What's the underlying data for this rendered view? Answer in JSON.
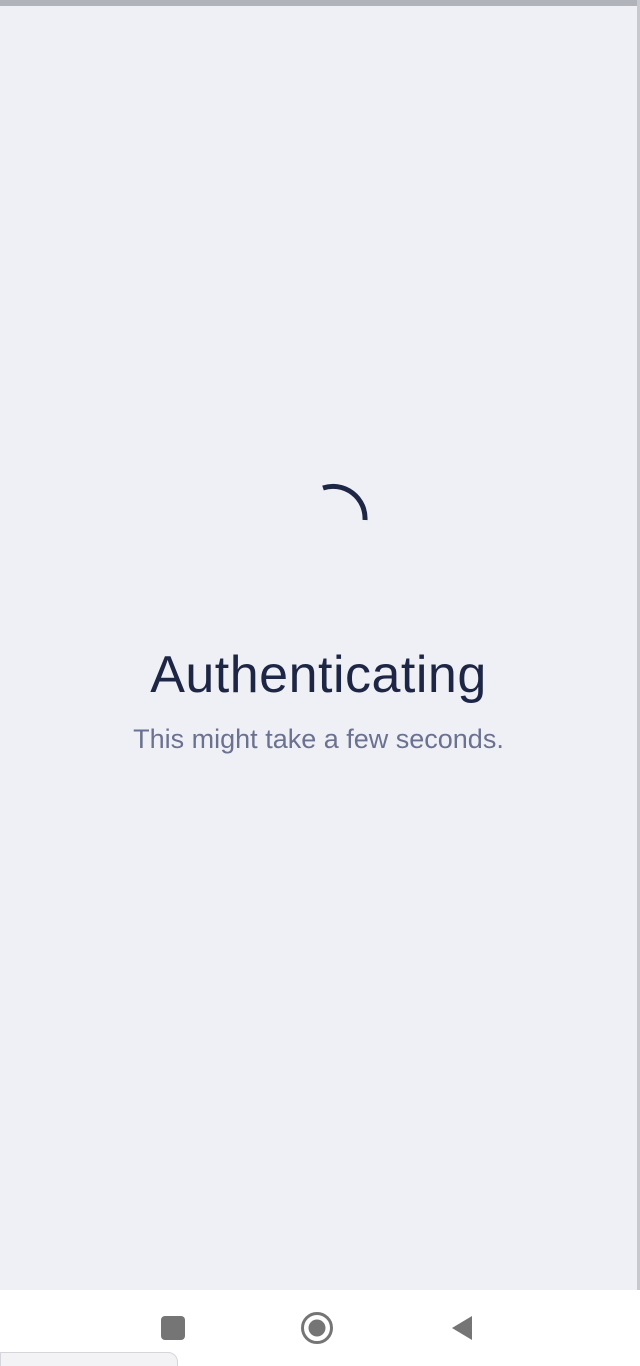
{
  "loading": {
    "title": "Authenticating",
    "subtitle": "This might take a few seconds."
  },
  "icons": {
    "spinner": "loading-spinner-icon",
    "recents": "square-icon",
    "home": "circle-home-icon",
    "back": "back-triangle-icon"
  },
  "colors": {
    "background": "#eff0f5",
    "title": "#1e2645",
    "subtitle": "#6b7190",
    "spinner": "#1e2645",
    "nav_icon": "#757575",
    "nav_bar": "#ffffff"
  }
}
